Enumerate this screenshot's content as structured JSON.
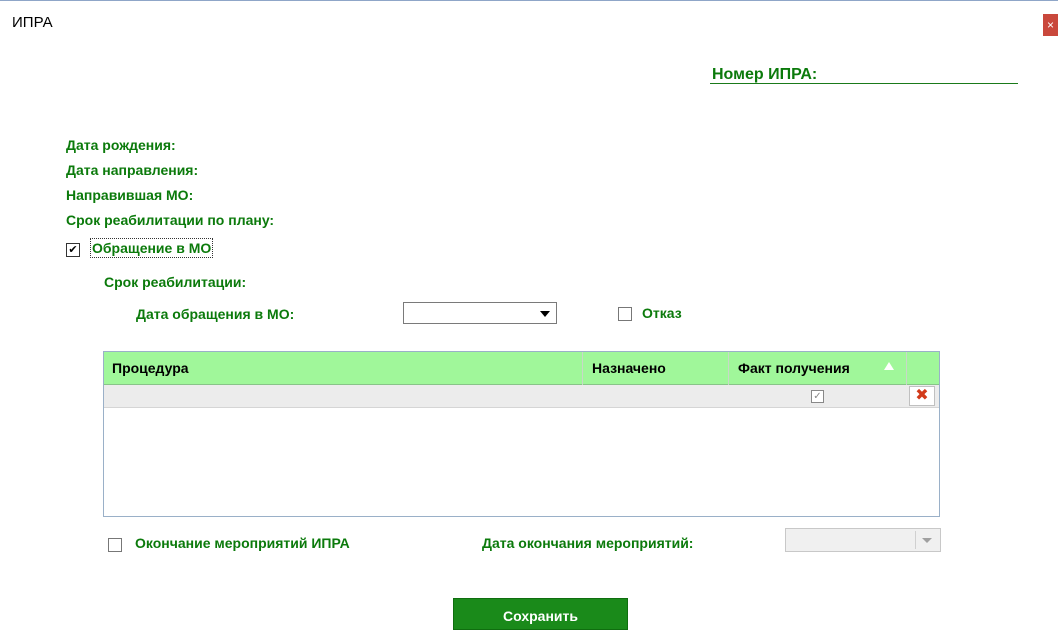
{
  "window": {
    "title": "ИПРА",
    "close_glyph": "×"
  },
  "header": {
    "ipra_number_label": "Номер ИПРА:"
  },
  "fields": {
    "birth_date": "Дата рождения:",
    "referral_date": "Дата направления:",
    "referring_mo": "Направившая МО:",
    "planned_rehab_term": "Срок реабилитации по плану:"
  },
  "appeal": {
    "checkbox_label": "Обращение в МО",
    "checked": true,
    "rehab_term_label": "Срок реабилитации:",
    "appeal_date_label": "Дата обращения в МО:",
    "appeal_date_value": "",
    "refusal_label": "Отказ",
    "refusal_checked": false
  },
  "procedures_grid": {
    "columns": [
      "Процедура",
      "Назначено",
      "Факт получения"
    ],
    "rows": [
      {
        "procedure": "",
        "assigned": "",
        "received": true
      }
    ]
  },
  "end": {
    "checkbox_label": "Окончание мероприятий ИПРА",
    "checked": false,
    "end_date_label": "Дата окончания мероприятий:",
    "end_date_value": ""
  },
  "buttons": {
    "save": "Сохранить"
  },
  "icons": {
    "delete": "delete-x-icon",
    "check": "checkmark-icon",
    "sort": "sort-ascending-icon"
  },
  "colors": {
    "accent_green": "#0b7a0b",
    "grid_header": "#a0f79a",
    "save_button": "#1a8a1a",
    "delete_red": "#d23a1a"
  }
}
